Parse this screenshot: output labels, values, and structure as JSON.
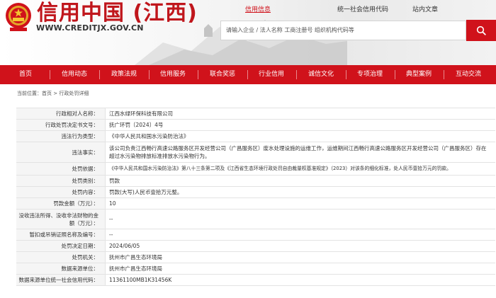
{
  "header": {
    "site_title": "信用中国 (江西)",
    "site_domain": "WWW.CREDITJX.GOV.CN",
    "links": [
      {
        "label": "信用信息",
        "active": true
      },
      {
        "label": "统一社会信用代码",
        "active": false
      },
      {
        "label": "站内文章",
        "active": false
      }
    ],
    "search_placeholder": "请输入企业 / 法人名称 工商注册号 组织机构代码等"
  },
  "nav": [
    "首页",
    "信用动态",
    "政策法规",
    "信用服务",
    "联合奖惩",
    "行业信用",
    "诚信文化",
    "专项治理",
    "典型案例",
    "互动交流"
  ],
  "breadcrumb": "当前位置：首页 > 行政处罚详细",
  "details": [
    {
      "label": "行政相对人名称：",
      "value": "江西水绿环保科技有限公司"
    },
    {
      "label": "行政处罚决定书文号：",
      "value": "抚广环罚〔2024〕4号"
    },
    {
      "label": "违法行为类型：",
      "value": "《中华人民共和国水污染防治法》"
    },
    {
      "label": "违法事实：",
      "value": "该公司负责江西畅行高速公路服务区开发经营公司（广昌服务区）废水处理设施的运维工作，运维期间江西畅行高速公路服务区开发经营公司（广昌服务区）存在超过水污染物排放标准排放水污染物行为。"
    },
    {
      "label": "处罚依据：",
      "value": "《中华人民共和国水污染防治法》第八十三条第二项及《江西省生态环境行政处罚自由裁量权基准规定》（2023）对该条的细化标准，处人民币壹拾万元的罚款。"
    },
    {
      "label": "处罚类别：",
      "value": "罚款"
    },
    {
      "label": "处罚内容：",
      "value": "罚款(大写)人民币壹拾万元整。"
    },
    {
      "label": "罚款金额（万元）：",
      "value": "10"
    },
    {
      "label": "没收违法所得、没收非法财物的金额（万元）：",
      "value": "--"
    },
    {
      "label": "暂扣或吊销证照名称及编号：",
      "value": "--"
    },
    {
      "label": "处罚决定日期：",
      "value": "2024/06/05"
    },
    {
      "label": "处罚机关：",
      "value": "抚州市广昌生态环境局"
    },
    {
      "label": "数据来源单位：",
      "value": "抚州市广昌生态环境局"
    },
    {
      "label": "数据来源单位统一社会信用代码：",
      "value": "11361100MB1K31456K"
    }
  ],
  "colors": {
    "brand_red": "#d0121b",
    "label_bg": "#f5f5f5",
    "border": "#e3e3e3"
  }
}
